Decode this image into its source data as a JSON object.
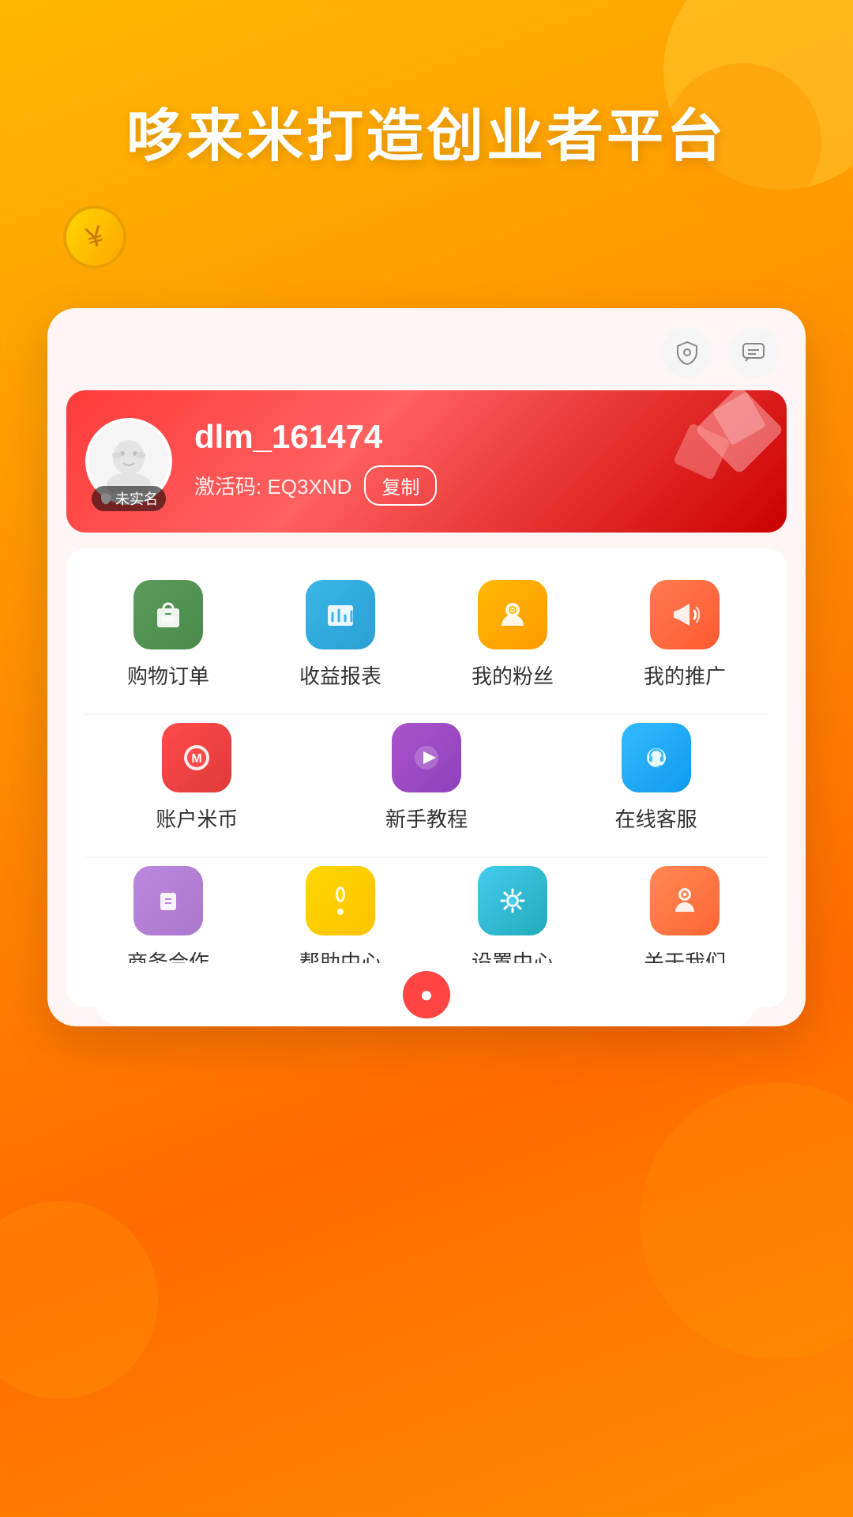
{
  "background": {
    "gradient_start": "#FFB800",
    "gradient_end": "#FF6B00"
  },
  "title": {
    "text": "哆来米打造创业者平台"
  },
  "card_icons": {
    "shield_label": "🛡",
    "chat_label": "💬"
  },
  "profile": {
    "username": "dlm_161474",
    "activation_prefix": "激活码: ",
    "activation_code": "EQ3XND",
    "copy_button": "复制",
    "unverified_label": "未实名"
  },
  "menu_row1": [
    {
      "id": "shopping",
      "label": "购物订单",
      "icon": "🛍"
    },
    {
      "id": "earnings",
      "label": "收益报表",
      "icon": "📊"
    },
    {
      "id": "fans",
      "label": "我的粉丝",
      "icon": "😊"
    },
    {
      "id": "promote",
      "label": "我的推广",
      "icon": "📢"
    }
  ],
  "menu_row2": [
    {
      "id": "coins",
      "label": "账户米币",
      "icon": "🎯"
    },
    {
      "id": "tutorial",
      "label": "新手教程",
      "icon": "▶"
    },
    {
      "id": "service",
      "label": "在线客服",
      "icon": "🎧"
    }
  ],
  "menu_row3": [
    {
      "id": "biz",
      "label": "商务合作",
      "icon": "👕"
    },
    {
      "id": "help",
      "label": "帮助中心",
      "icon": "💡"
    },
    {
      "id": "settings",
      "label": "设置中心",
      "icon": "⚙"
    },
    {
      "id": "about",
      "label": "关于我们",
      "icon": "😶"
    }
  ]
}
